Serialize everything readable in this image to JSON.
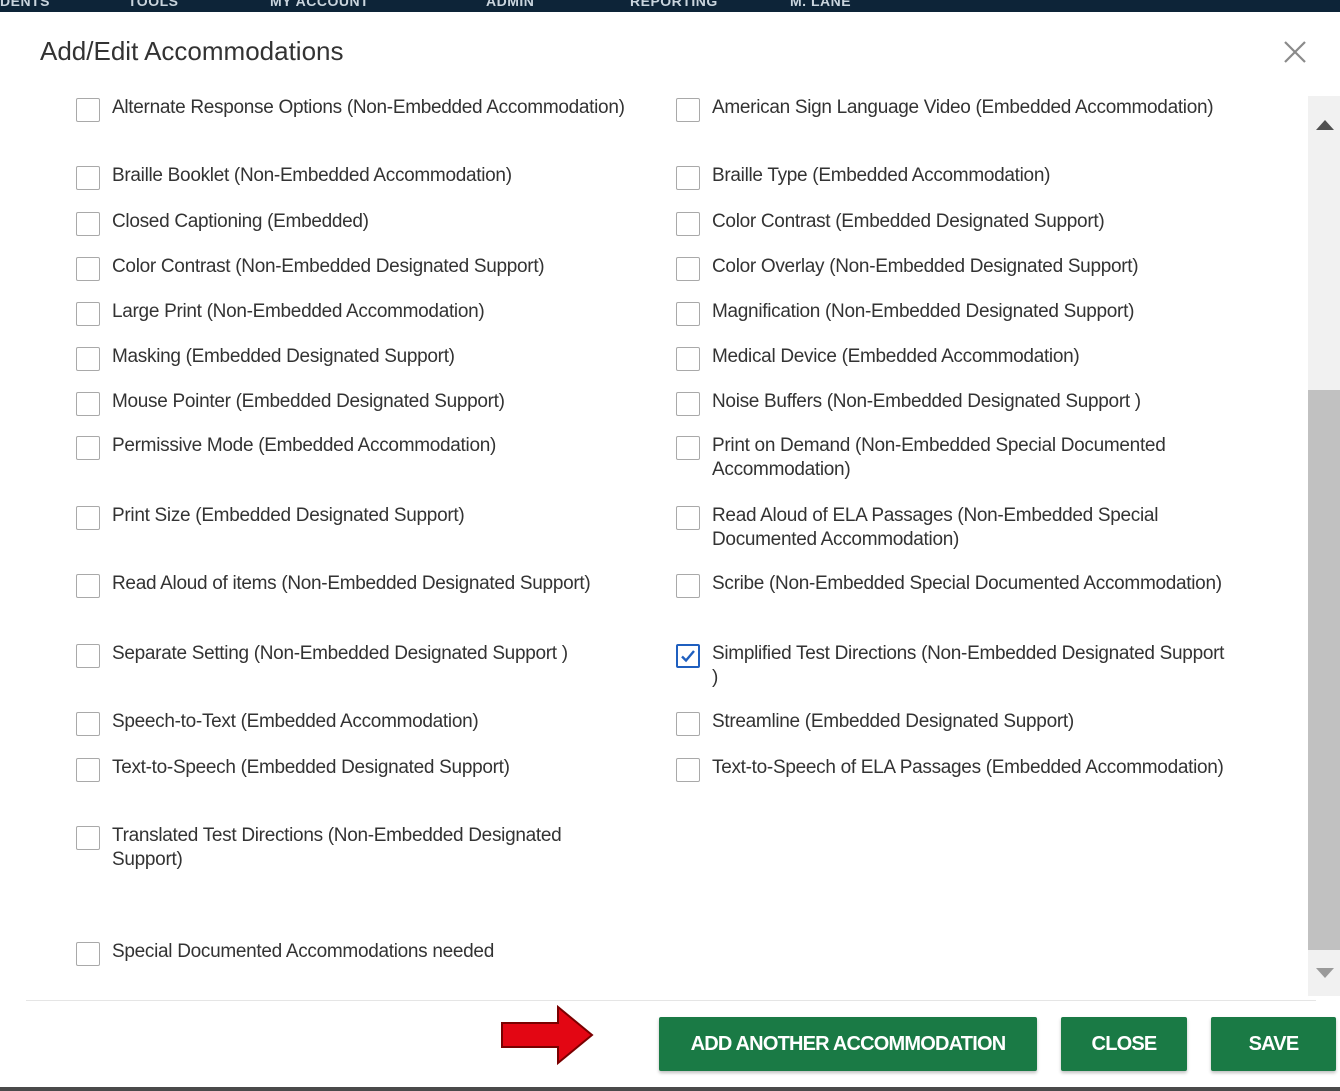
{
  "topnav": {
    "items": [
      "DENTS",
      "TOOLS",
      "MY ACCOUNT",
      "ADMIN",
      "REPORTING",
      "M. LANE"
    ]
  },
  "modal": {
    "title": "Add/Edit Accommodations",
    "close_icon": "close-icon"
  },
  "accommodations": [
    {
      "label": "Alternate Response Options (Non-Embedded Accommodation)",
      "checked": false
    },
    {
      "label": "American Sign Language Video (Embedded Accommodation)",
      "checked": false
    },
    {
      "label": "Braille Booklet (Non-Embedded Accommodation)",
      "checked": false
    },
    {
      "label": "Braille Type (Embedded Accommodation)",
      "checked": false
    },
    {
      "label": "Closed Captioning (Embedded)",
      "checked": false
    },
    {
      "label": "Color Contrast (Embedded Designated Support)",
      "checked": false
    },
    {
      "label": "Color Contrast (Non-Embedded Designated Support)",
      "checked": false
    },
    {
      "label": "Color Overlay (Non-Embedded Designated Support)",
      "checked": false
    },
    {
      "label": "Large Print (Non-Embedded Accommodation)",
      "checked": false
    },
    {
      "label": "Magnification (Non-Embedded Designated Support)",
      "checked": false
    },
    {
      "label": "Masking (Embedded Designated Support)",
      "checked": false
    },
    {
      "label": "Medical Device (Embedded Accommodation)",
      "checked": false
    },
    {
      "label": "Mouse Pointer (Embedded Designated Support)",
      "checked": false
    },
    {
      "label": "Noise Buffers (Non-Embedded Designated Support )",
      "checked": false
    },
    {
      "label": "Permissive Mode (Embedded Accommodation)",
      "checked": false
    },
    {
      "label": "Print on Demand (Non-Embedded Special Documented Accommodation)",
      "checked": false
    },
    {
      "label": "Print Size (Embedded Designated Support)",
      "checked": false
    },
    {
      "label": "Read Aloud of ELA Passages (Non-Embedded Special Documented Accommodation)",
      "checked": false
    },
    {
      "label": "Read Aloud of items (Non-Embedded Designated Support)",
      "checked": false
    },
    {
      "label": "Scribe (Non-Embedded Special Documented Accommodation)",
      "checked": false
    },
    {
      "label": "Separate Setting (Non-Embedded Designated Support )",
      "checked": false
    },
    {
      "label": "Simplified Test Directions (Non-Embedded Designated Support )",
      "checked": true
    },
    {
      "label": "Speech-to-Text (Embedded Accommodation)",
      "checked": false
    },
    {
      "label": "Streamline (Embedded Designated Support)",
      "checked": false
    },
    {
      "label": "Text-to-Speech (Embedded Designated Support)",
      "checked": false
    },
    {
      "label": "Text-to-Speech of ELA Passages (Embedded Accommodation)",
      "checked": false
    },
    {
      "label": "Translated Test Directions (Non-Embedded Designated Support)",
      "checked": false
    }
  ],
  "special": {
    "label": "Special Documented Accommodations needed",
    "checked": false
  },
  "footer": {
    "add_another_label": "ADD ANOTHER ACCOMMODATION",
    "close_label": "CLOSE",
    "save_label": "SAVE",
    "arrow_icon": "red-arrow-right-icon"
  },
  "colors": {
    "button_green": "#1a7a45",
    "checkbox_checked": "#1f5fbf",
    "arrow_red": "#e30613",
    "nav_bg": "#0d2438"
  }
}
